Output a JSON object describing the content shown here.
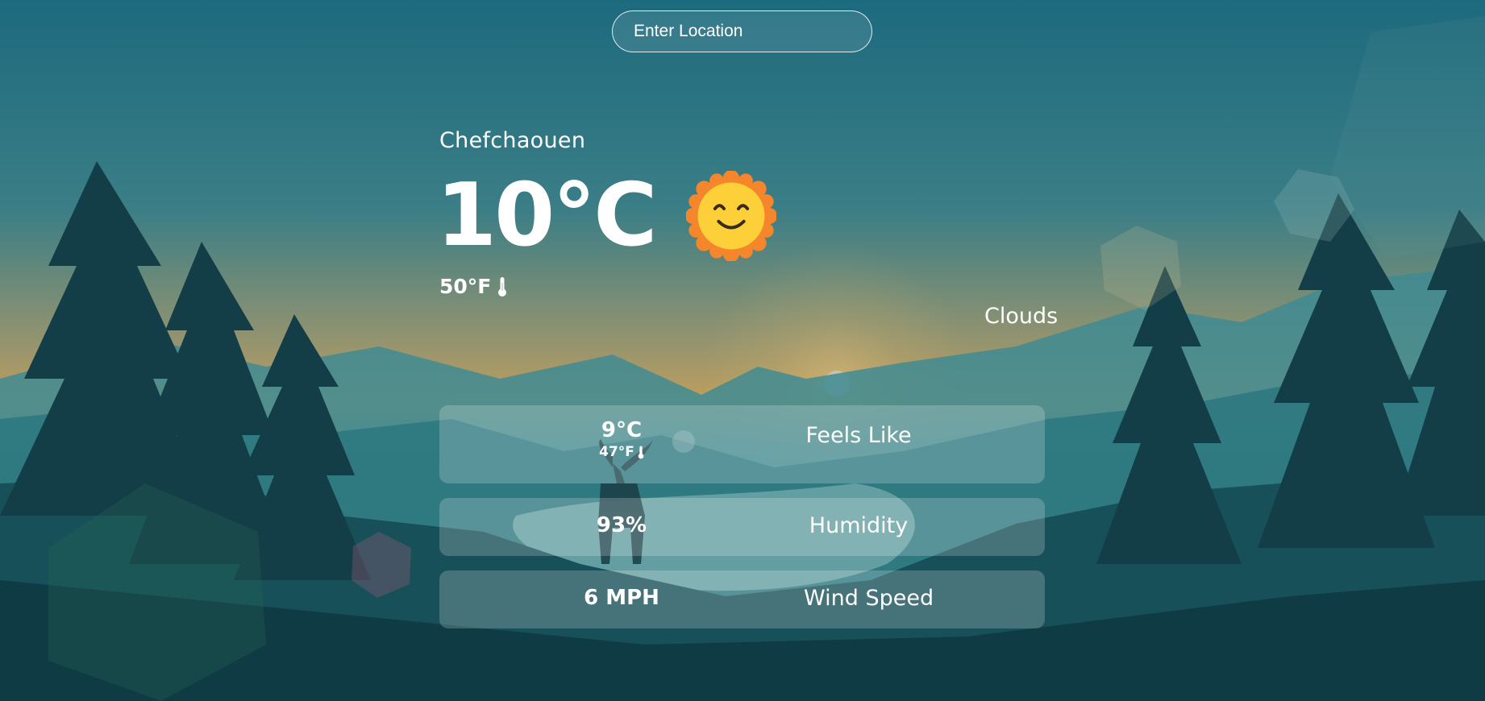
{
  "search": {
    "placeholder": "Enter Location",
    "value": ""
  },
  "weather": {
    "city": "Chefchaouen",
    "temp_c": "10°C",
    "temp_f": "50°F",
    "condition_icon": "smiling-sun-icon",
    "description": "Clouds"
  },
  "details": {
    "feels_like": {
      "value_c": "9°C",
      "value_f": "47°F",
      "label": "Feels Like"
    },
    "humidity": {
      "value": "93%",
      "label": "Humidity"
    },
    "wind": {
      "value": "6 MPH",
      "label": "Wind Speed"
    }
  },
  "theme": {
    "sky_top": "#1f6c80",
    "sky_glow": "#c9a65a",
    "forest_dark": "#0d3a42",
    "card_bg": "rgba(255,255,255,0.20)",
    "text": "#ffffff",
    "sun_orange": "#f5862b",
    "sun_yellow": "#fdd03a"
  }
}
